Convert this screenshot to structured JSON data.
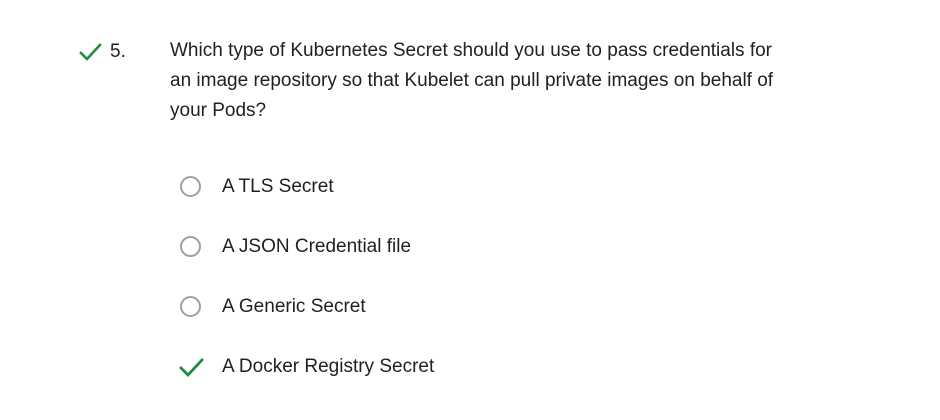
{
  "question": {
    "number": "5.",
    "text": "Which type of Kubernetes Secret should you use to pass credentials for an image repository so that Kubelet can pull private images on behalf of your Pods?",
    "status_icon": "check-icon",
    "accent_color": "#1e8e3e"
  },
  "options": [
    {
      "label": "A TLS Secret",
      "state": "unselected"
    },
    {
      "label": "A JSON Credential file",
      "state": "unselected"
    },
    {
      "label": "A Generic Secret",
      "state": "unselected"
    },
    {
      "label": "A Docker Registry Secret",
      "state": "correct",
      "icon": "check-icon"
    }
  ]
}
